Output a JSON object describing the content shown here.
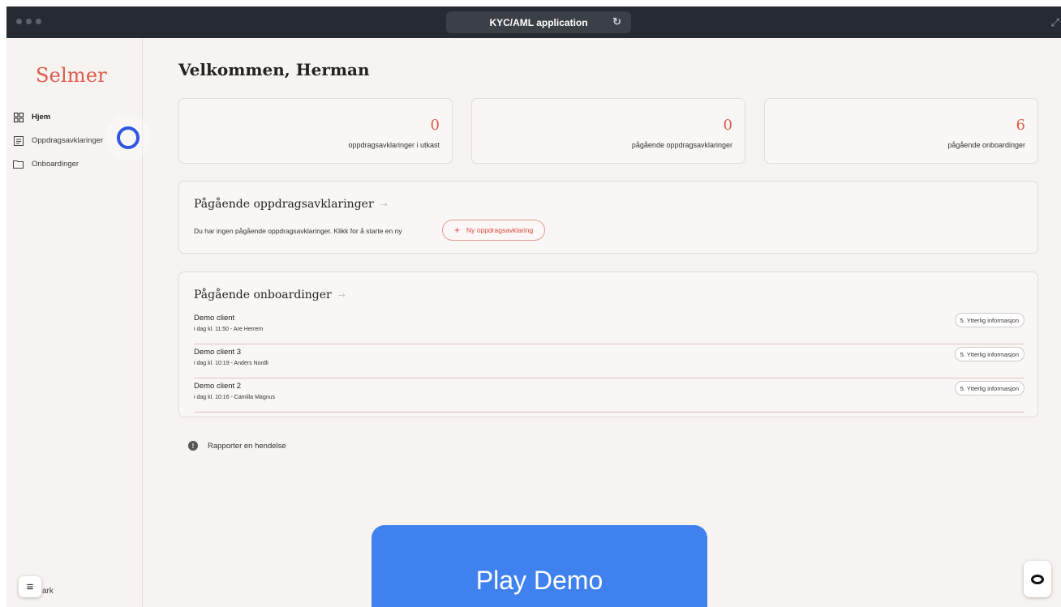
{
  "window": {
    "title": "KYC/AML application"
  },
  "sidebar": {
    "logo": "Selmer",
    "items": [
      {
        "label": "Hjem",
        "icon": "dashboard-icon",
        "active": true
      },
      {
        "label": "Oppdragsavklaringer",
        "icon": "document-list-icon",
        "active": false
      },
      {
        "label": "Onboardinger",
        "icon": "folder-icon",
        "active": false
      }
    ],
    "bottom_label": "ark"
  },
  "main": {
    "welcome": "Velkommen, Herman",
    "stats": [
      {
        "value": "0",
        "label": "oppdragsavklaringer i utkast"
      },
      {
        "value": "0",
        "label": "pågående oppdragsavklaringer"
      },
      {
        "value": "6",
        "label": "pågående onboardinger"
      }
    ],
    "assignments": {
      "title": "Pågående oppdragsavklaringer",
      "arrow": "→",
      "empty_text": "Du har ingen pågående oppdragsavklaringer. Klikk for å starte en ny",
      "new_button": "Ny oppdragsavklaring"
    },
    "onboardings": {
      "title": "Pågående onboardinger",
      "arrow": "→",
      "rows": [
        {
          "name": "Demo client",
          "meta": "i dag kl. 11:50 - Are Herrem",
          "status": "5. Ytterlig informasjon"
        },
        {
          "name": "Demo client 3",
          "meta": "i dag kl. 10:19 - Anders Nordli",
          "status": "5. Ytterlig informasjon"
        },
        {
          "name": "Demo client 2",
          "meta": "i dag kl. 10:16 - Camilla Magnus",
          "status": "5. Ytterlig informasjon"
        }
      ]
    },
    "report": "Rapporter en hendelse"
  },
  "overlay": {
    "play_demo": "Play Demo"
  },
  "colors": {
    "accent": "#dd5a4c",
    "play_demo": "#3f82ef",
    "cursor": "#2f55e4",
    "titlebar": "#262a31"
  }
}
